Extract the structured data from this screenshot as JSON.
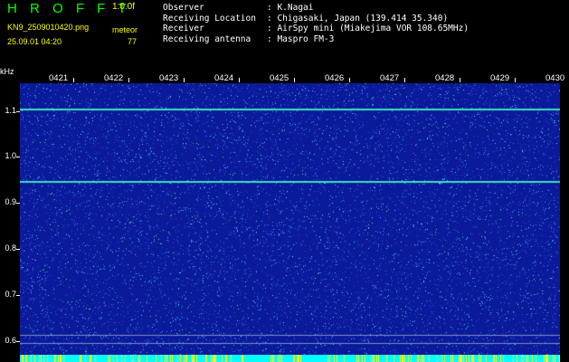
{
  "header": {
    "brand": "H R O F F T",
    "version": "1.0.0f",
    "filename": "KN9_2509010420.png",
    "meteor_label": "meteor",
    "datetime": "25.09.01 04:20",
    "meteor_count": "77"
  },
  "info": [
    {
      "key": "Observer",
      "value": ": K.Nagai"
    },
    {
      "key": "Receiving Location",
      "value": ": Chigasaki, Japan (139.414 35.340)"
    },
    {
      "key": "Receiver",
      "value": ": AirSpy mini (Miakejima VOR 108.65MHz)"
    },
    {
      "key": "Receiving antenna",
      "value": ": Maspro FM-3"
    }
  ],
  "axis": {
    "unit": "kHz",
    "y_labels": [
      "1.1",
      "1.0",
      "0.9",
      "0.8",
      "0.7",
      "0.6"
    ],
    "y_values": [
      1.1,
      1.0,
      0.9,
      0.8,
      0.7,
      0.6
    ],
    "y_range": [
      0.57,
      1.16
    ],
    "x_labels": [
      "0421",
      "0422",
      "0423",
      "0424",
      "0425",
      "0426",
      "0427",
      "0428",
      "0429",
      "0430"
    ]
  },
  "signals_khz": [
    1.104,
    0.947
  ],
  "colors": {
    "background": "#0a1a9a",
    "signal": "#40e0c0",
    "noise_bright": "#30ff60",
    "bottom_band": "#00ffff",
    "marks": "#ffff00"
  }
}
